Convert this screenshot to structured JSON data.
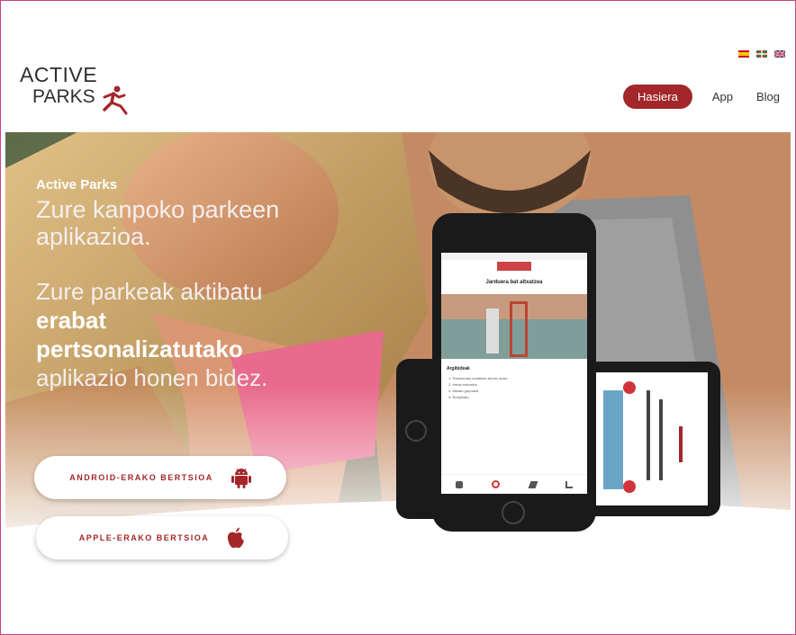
{
  "header": {
    "logo_line1": "ACTIVE",
    "logo_line2": "PARKS",
    "languages": [
      "es",
      "eu",
      "en"
    ],
    "nav": [
      {
        "label": "Hasiera",
        "active": true
      },
      {
        "label": "App",
        "active": false
      },
      {
        "label": "Blog",
        "active": false
      }
    ]
  },
  "hero": {
    "brand": "Active Parks",
    "tagline_1": "Zure kanpoko parkeen",
    "tagline_2": "aplikazioa.",
    "lead_1": "Zure parkeak aktibatu",
    "lead_bold_1": "erabat",
    "lead_bold_2": "pertsonalizatutako",
    "lead_2": "aplikazio honen bidez."
  },
  "buttons": {
    "android_label": "ANDROID-ERAKO BERTSIOA",
    "apple_label": "APPLE-ERAKO BERTSIOA",
    "android_icon": "android-icon",
    "apple_icon": "apple-icon"
  },
  "phone_screen": {
    "title": "Jarduera bat altxatzea",
    "section": "Argibideak",
    "steps": [
      "1. Posizionatu zutabean aurrez aurre",
      "2. Heldu eskuekin",
      "3. Altxatu gorputza",
      "4. Errepikatu"
    ]
  },
  "colors": {
    "accent": "#a3262a",
    "frame": "#c6457d"
  }
}
